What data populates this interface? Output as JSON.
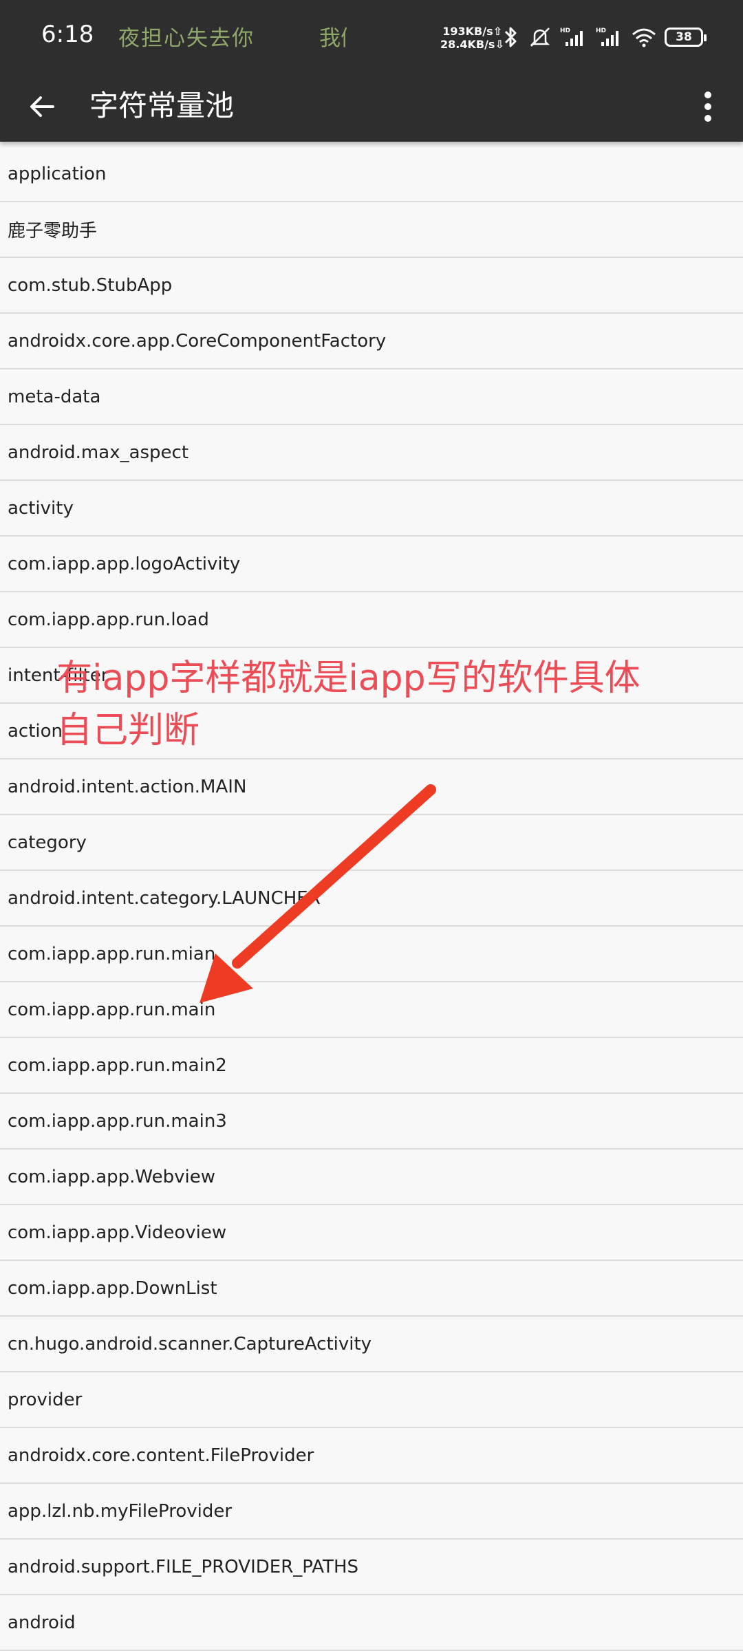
{
  "status_bar": {
    "time": "6:18",
    "lyric_left": "夜担心失去你",
    "lyric_right": "我们",
    "net_up": "193KB/s⇧",
    "net_down": "28.4KB/s⇩",
    "battery": "38",
    "icons": [
      "bluetooth-icon",
      "mute-icon",
      "hd-signal-icon",
      "hd-signal-icon",
      "wifi-icon",
      "battery-icon"
    ]
  },
  "app_bar": {
    "title": "字符常量池",
    "back_icon": "arrow-left-icon",
    "menu_icon": "more-vertical-icon"
  },
  "strings": [
    "application",
    "鹿子零助手",
    "com.stub.StubApp",
    "androidx.core.app.CoreComponentFactory",
    "meta-data",
    "android.max_aspect",
    "activity",
    "com.iapp.app.logoActivity",
    "com.iapp.app.run.load",
    "intent-filter",
    "action",
    "android.intent.action.MAIN",
    "category",
    "android.intent.category.LAUNCHER",
    "com.iapp.app.run.mian",
    "com.iapp.app.run.main",
    "com.iapp.app.run.main2",
    "com.iapp.app.run.main3",
    "com.iapp.app.Webview",
    "com.iapp.app.Videoview",
    "com.iapp.app.DownList",
    "cn.hugo.android.scanner.CaptureActivity",
    "provider",
    "androidx.core.content.FileProvider",
    "app.lzl.nb.myFileProvider",
    "android.support.FILE_PROVIDER_PATHS",
    "android"
  ],
  "annotation": {
    "line1": "有iapp字样都就是iapp写的软件具体",
    "line2": "自己判断",
    "color": "#eb4c55",
    "arrow_color": "#ee3b24"
  },
  "colors": {
    "bar_background": "#2e2e2e",
    "list_background": "#f8f8f8",
    "divider": "#dcdcdc",
    "lyric": "#8fa86a"
  }
}
